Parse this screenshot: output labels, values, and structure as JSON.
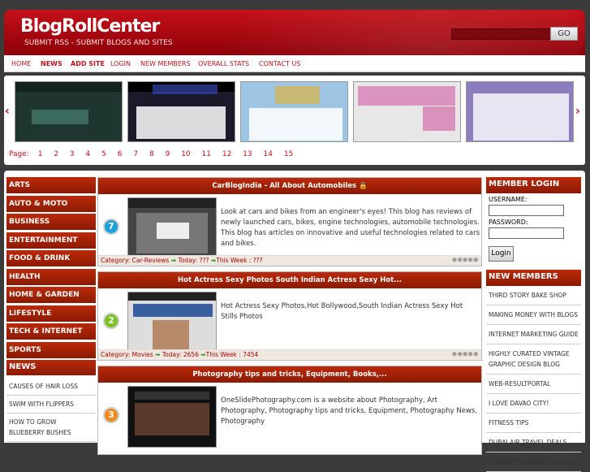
{
  "header": {
    "logo": "BlogRollCenter",
    "tagline": "SUBMIT RSS - SUBMIT BLOGS AND SITES",
    "search_placeholder": "",
    "go_label": "GO"
  },
  "nav": [
    {
      "label": "HOME"
    },
    {
      "label": "NEWS"
    },
    {
      "label": "ADD SITE"
    },
    {
      "label": "LOGIN"
    },
    {
      "label": "NEW MEMBERS"
    },
    {
      "label": "OVERALL STATS"
    },
    {
      "label": "CONTACT US"
    }
  ],
  "gallery": {
    "prev_icon": "‹",
    "next_icon": "›",
    "pager_label": "Page:",
    "pages": [
      "1",
      "2",
      "3",
      "4",
      "5",
      "6",
      "7",
      "8",
      "9",
      "10",
      "11",
      "12",
      "13",
      "14",
      "15"
    ]
  },
  "categories": [
    {
      "label": "ARTS"
    },
    {
      "label": "AUTO & MOTO"
    },
    {
      "label": "BUSINESS"
    },
    {
      "label": "ENTERTAINMENT"
    },
    {
      "label": "FOOD & DRINK"
    },
    {
      "label": "HEALTH"
    },
    {
      "label": "HOME & GARDEN"
    },
    {
      "label": "LIFESTYLE"
    },
    {
      "label": "TECH & INTERNET"
    },
    {
      "label": "SPORTS"
    }
  ],
  "news": {
    "heading": "NEWS",
    "items": [
      {
        "label": "CAUSES OF HAIR LOSS"
      },
      {
        "label": "SWIM WITH FLIPPERS"
      },
      {
        "label": "HOW TO GROW BLUEBERRY BUSHES"
      }
    ]
  },
  "posts": [
    {
      "title": "CarBlogIndia - All About Automobiles",
      "num": "7",
      "num_color": "#1aa0d8",
      "desc": "Look at cars and bikes from an engineer's eyes! This blog has reviews of newly launched cars, bikes, engine technologies, automobile technologies. This blog has articles on innovative and useful technologies related to cars and bikes.",
      "category_label": "Category:",
      "category": "Car-Reviews",
      "today_label": "Today:",
      "today": "???",
      "week_label": "This Week :",
      "week": "???"
    },
    {
      "title": "Hot Actress Sexy Photos South Indian Actress Sexy Hot...",
      "num": "2",
      "num_color": "#7ac21e",
      "desc": "Hot Actress Sexy Photos,Hot Bollywood,South Indian Actress Sexy Hot Stills Photos",
      "category_label": "Category:",
      "category": "Movies",
      "today_label": "Today:",
      "today": "2656",
      "week_label": "This Week :",
      "week": "7454"
    },
    {
      "title": "Photography tips and tricks, Equipment, Books,...",
      "num": "3",
      "num_color": "#f08a1a",
      "desc": "OneSlidePhotography.com is a website about Photography, Art Photography, Photography tips and tricks, Equipment, Photography News, Photography"
    }
  ],
  "login": {
    "heading": "MEMBER LOGIN",
    "username_label": "USERNAME:",
    "password_label": "PASSWORD:",
    "button": "Login"
  },
  "new_members": {
    "heading": "NEW MEMBERS",
    "items": [
      {
        "label": "THIRD STORY BAKE SHOP"
      },
      {
        "label": "MAKING MONEY WITH BLOGS"
      },
      {
        "label": "INTERNET MARKETING GUIDE"
      },
      {
        "label": "HIGHLY CURATED VINTAGE GRAPHIC DESIGN BLOG"
      },
      {
        "label": "WEB-RESULTPORTAL"
      },
      {
        "label": "I LOVE DAVAO CITY!"
      },
      {
        "label": "FITNESS TIPS"
      },
      {
        "label": "DUBAI AIR TRAVEL DEALS"
      },
      {
        "label": "TONIGHT'S DINNER RECIPES"
      }
    ]
  }
}
